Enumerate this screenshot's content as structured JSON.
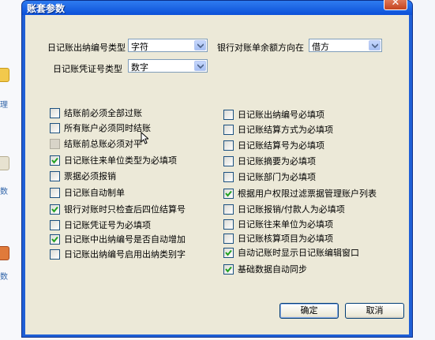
{
  "dialog": {
    "title": "账套参数"
  },
  "side": {
    "labels": [
      "理",
      "数",
      "数"
    ]
  },
  "top_fields": {
    "journal_number_type": {
      "label": "日记账出纳编号类型",
      "value": "字符"
    },
    "bank_balance_direction": {
      "label": "银行对账单余额方向在",
      "value": "借方"
    },
    "voucher_number_type": {
      "label": "日记账凭证号类型",
      "value": "数字"
    }
  },
  "left_options": [
    {
      "label": "结账前必须全部过账",
      "checked": false,
      "disabled": false
    },
    {
      "label": "所有账户必须同时结账",
      "checked": false,
      "disabled": false
    },
    {
      "label": "结账前总账必须对平",
      "checked": false,
      "disabled": true
    },
    {
      "label": "日记账往来单位类型为必填项",
      "checked": true,
      "disabled": false
    },
    {
      "label": "票据必须报销",
      "checked": false,
      "disabled": false
    },
    {
      "label": "日记账自动制单",
      "checked": false,
      "disabled": false
    },
    {
      "label": "银行对账时只检查后四位结算号",
      "checked": true,
      "disabled": false
    },
    {
      "label": "日记账凭证号为必填项",
      "checked": false,
      "disabled": false
    },
    {
      "label": "日记账中出纳编号是否自动增加",
      "checked": true,
      "disabled": false
    },
    {
      "label": "日记账出纳编号启用出纳类别字",
      "checked": false,
      "disabled": false
    }
  ],
  "right_options": [
    {
      "label": "日记账出纳编号必填项",
      "checked": false
    },
    {
      "label": "日记账结算方式为必填项",
      "checked": false
    },
    {
      "label": "日记账结算号为必填项",
      "checked": false
    },
    {
      "label": "日记账摘要为必填项",
      "checked": false
    },
    {
      "label": "日记账部门为必填项",
      "checked": false
    },
    {
      "label": "根据用户权限过滤票据管理账户列表",
      "checked": true
    },
    {
      "label": "日记账报销/付款人为必填项",
      "checked": false
    },
    {
      "label": "日记账往来单位为必填项",
      "checked": false
    },
    {
      "label": "日记账核算项目为必填项",
      "checked": false
    },
    {
      "label": "自动记账时显示日记账编辑窗口",
      "checked": true
    },
    {
      "label": "基础数据自动同步",
      "checked": true
    }
  ],
  "buttons": {
    "ok": "确定",
    "cancel": "取消"
  },
  "colors": {
    "title_bar": "#0c50d8",
    "dialog_face": "#ece9d8",
    "check": "#21a121"
  }
}
